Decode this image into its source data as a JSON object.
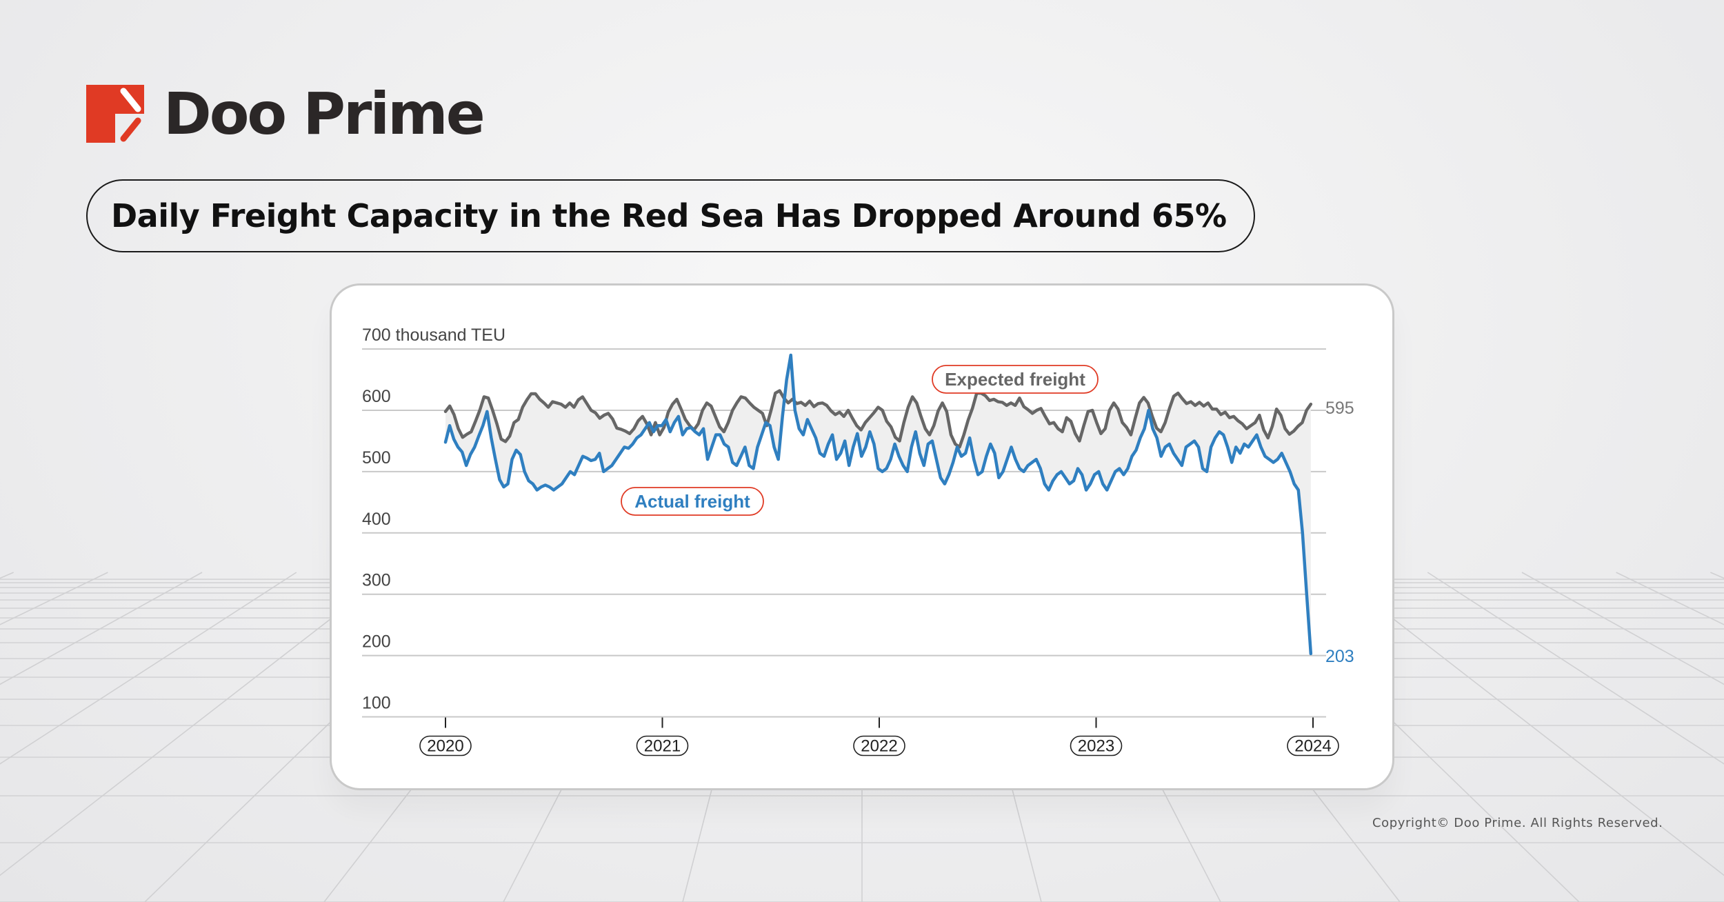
{
  "brand": {
    "name": "Doo Prime",
    "accent_color": "#e03a24"
  },
  "headline": "Daily Freight Capacity in the Red Sea Has Dropped Around 65%",
  "copyright": "Copyright© Doo Prime. All Rights Reserved.",
  "chart_data": {
    "type": "line",
    "title": "Daily Freight Capacity in the Red Sea Has Dropped Around 65%",
    "ylabel": "thousand TEU",
    "ylabel_display": "700 thousand TEU",
    "xlabel": "",
    "ylim": [
      100,
      700
    ],
    "yticks": [
      100,
      200,
      300,
      400,
      500,
      600,
      700
    ],
    "ytick_labels": [
      "100",
      "200",
      "300",
      "400",
      "500",
      "600",
      "700 thousand TEU"
    ],
    "xlim": [
      2020.0,
      2024.0
    ],
    "xticks": [
      2020,
      2021,
      2022,
      2023,
      2024
    ],
    "xtick_labels": [
      "2020",
      "2021",
      "2022",
      "2023",
      "2024"
    ],
    "grid": true,
    "gap_fill_color": "#efefef",
    "series": [
      {
        "name": "Expected freight",
        "color": "#666666",
        "end_label": "595",
        "x_start": 2020.0,
        "x_end": 2023.99,
        "values": [
          598,
          607,
          593,
          570,
          556,
          561,
          565,
          582,
          600,
          622,
          620,
          600,
          578,
          553,
          549,
          558,
          580,
          585,
          605,
          617,
          627,
          627,
          618,
          612,
          605,
          614,
          612,
          610,
          605,
          612,
          605,
          617,
          622,
          611,
          600,
          596,
          587,
          592,
          595,
          586,
          571,
          569,
          566,
          562,
          570,
          583,
          590,
          578,
          560,
          580,
          560,
          572,
          597,
          610,
          618,
          602,
          585,
          575,
          568,
          578,
          600,
          612,
          607,
          590,
          573,
          565,
          580,
          600,
          612,
          622,
          620,
          612,
          605,
          600,
          595,
          575,
          600,
          628,
          632,
          620,
          612,
          618,
          611,
          613,
          608,
          615,
          606,
          611,
          612,
          608,
          599,
          593,
          597,
          590,
          600,
          587,
          575,
          568,
          580,
          588,
          596,
          605,
          600,
          582,
          573,
          556,
          550,
          580,
          605,
          622,
          612,
          590,
          570,
          560,
          575,
          599,
          612,
          598,
          560,
          545,
          540,
          560,
          584,
          603,
          628,
          628,
          624,
          616,
          618,
          614,
          613,
          608,
          612,
          608,
          620,
          606,
          601,
          595,
          600,
          603,
          590,
          578,
          580,
          570,
          565,
          588,
          582,
          562,
          550,
          575,
          598,
          600,
          580,
          562,
          570,
          600,
          612,
          602,
          580,
          572,
          560,
          587,
          612,
          621,
          612,
          590,
          571,
          565,
          580,
          603,
          623,
          628,
          619,
          611,
          614,
          608,
          613,
          607,
          612,
          602,
          602,
          593,
          597,
          588,
          590,
          583,
          578,
          570,
          575,
          580,
          592,
          568,
          555,
          574,
          602,
          592,
          570,
          561,
          566,
          574,
          580,
          600,
          610
        ]
      },
      {
        "name": "Actual freight",
        "color": "#2f7fc0",
        "end_label": "203",
        "x_start": 2020.0,
        "x_end": 2023.99,
        "values": [
          548,
          575,
          553,
          540,
          532,
          510,
          528,
          540,
          558,
          575,
          598,
          555,
          520,
          487,
          475,
          480,
          520,
          535,
          528,
          500,
          485,
          480,
          470,
          475,
          478,
          475,
          470,
          475,
          480,
          490,
          500,
          495,
          510,
          525,
          522,
          518,
          520,
          530,
          500,
          505,
          510,
          520,
          530,
          540,
          538,
          545,
          555,
          560,
          570,
          580,
          565,
          575,
          575,
          585,
          565,
          580,
          590,
          560,
          570,
          572,
          565,
          560,
          570,
          520,
          540,
          560,
          560,
          545,
          540,
          515,
          510,
          525,
          540,
          510,
          505,
          540,
          560,
          580,
          575,
          540,
          520,
          590,
          650,
          690,
          600,
          570,
          560,
          585,
          570,
          555,
          530,
          525,
          545,
          560,
          520,
          530,
          550,
          510,
          540,
          562,
          525,
          540,
          565,
          545,
          505,
          500,
          505,
          520,
          545,
          525,
          510,
          500,
          540,
          565,
          530,
          510,
          545,
          550,
          520,
          490,
          480,
          495,
          515,
          540,
          525,
          530,
          555,
          520,
          495,
          500,
          525,
          545,
          530,
          490,
          500,
          520,
          540,
          520,
          505,
          500,
          510,
          515,
          520,
          505,
          480,
          470,
          485,
          495,
          500,
          490,
          480,
          485,
          505,
          495,
          470,
          480,
          495,
          500,
          480,
          470,
          485,
          500,
          505,
          495,
          505,
          525,
          535,
          555,
          570,
          600,
          570,
          555,
          525,
          540,
          545,
          530,
          520,
          510,
          540,
          545,
          550,
          540,
          505,
          500,
          540,
          555,
          565,
          560,
          540,
          515,
          540,
          530,
          545,
          540,
          550,
          560,
          540,
          525,
          520,
          515,
          520,
          530,
          515,
          500,
          480,
          470,
          400,
          300,
          203
        ]
      }
    ],
    "annotations": [
      {
        "text": "Expected freight",
        "series": "Expected freight",
        "style": "pill with red outline"
      },
      {
        "text": "Actual freight",
        "series": "Actual freight",
        "style": "pill with red outline"
      }
    ]
  }
}
